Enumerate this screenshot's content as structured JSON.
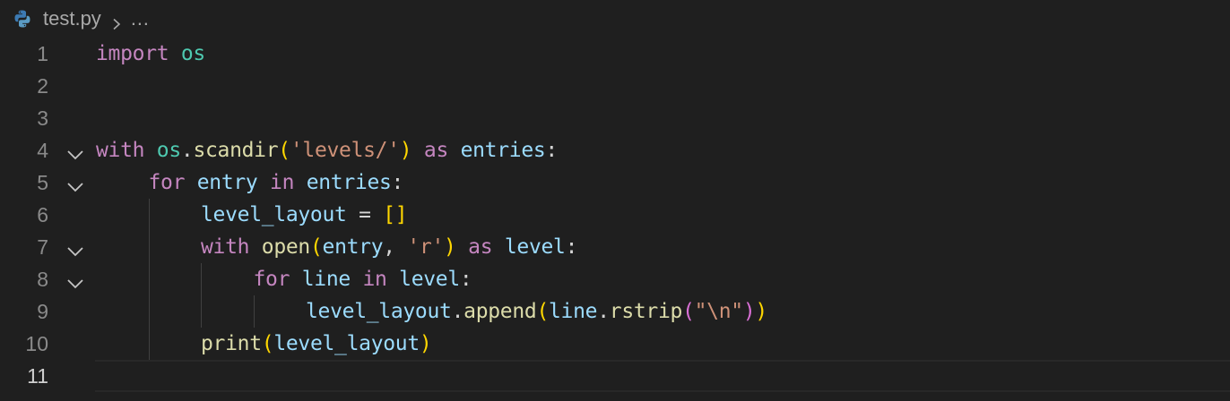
{
  "breadcrumb": {
    "file_icon": "python-file-icon",
    "file_name": "test.py",
    "separator_icon": "chevron-right-icon",
    "more": "…"
  },
  "editor": {
    "current_line": 11,
    "fold_icon": "chevron-down-icon",
    "colors": {
      "background": "#1f1f1f",
      "keyword": "#c586c0",
      "module": "#4ec9b0",
      "variable": "#9cdcfe",
      "function": "#dcdcaa",
      "string": "#ce9178",
      "bracket_level1": "#ffd700",
      "bracket_level2": "#da70d6"
    },
    "lines": [
      {
        "number": "1",
        "foldable": false,
        "indent": 0,
        "tokens": [
          {
            "text": "import",
            "kind": "keyword"
          },
          {
            "text": " ",
            "kind": "punct"
          },
          {
            "text": "os",
            "kind": "module"
          }
        ]
      },
      {
        "number": "2",
        "foldable": false,
        "indent": 0,
        "tokens": []
      },
      {
        "number": "3",
        "foldable": false,
        "indent": 0,
        "tokens": []
      },
      {
        "number": "4",
        "foldable": true,
        "indent": 0,
        "tokens": [
          {
            "text": "with",
            "kind": "keyword"
          },
          {
            "text": " ",
            "kind": "punct"
          },
          {
            "text": "os",
            "kind": "module"
          },
          {
            "text": ".",
            "kind": "punct"
          },
          {
            "text": "scandir",
            "kind": "func"
          },
          {
            "text": "(",
            "kind": "paren1"
          },
          {
            "text": "'levels/'",
            "kind": "string"
          },
          {
            "text": ")",
            "kind": "paren1"
          },
          {
            "text": " ",
            "kind": "punct"
          },
          {
            "text": "as",
            "kind": "keyword"
          },
          {
            "text": " ",
            "kind": "punct"
          },
          {
            "text": "entries",
            "kind": "var"
          },
          {
            "text": ":",
            "kind": "punct"
          }
        ]
      },
      {
        "number": "5",
        "foldable": true,
        "indent": 1,
        "tokens": [
          {
            "text": "for",
            "kind": "keyword"
          },
          {
            "text": " ",
            "kind": "punct"
          },
          {
            "text": "entry",
            "kind": "var"
          },
          {
            "text": " ",
            "kind": "punct"
          },
          {
            "text": "in",
            "kind": "keyword"
          },
          {
            "text": " ",
            "kind": "punct"
          },
          {
            "text": "entries",
            "kind": "var"
          },
          {
            "text": ":",
            "kind": "punct"
          }
        ]
      },
      {
        "number": "6",
        "foldable": false,
        "indent": 2,
        "tokens": [
          {
            "text": "level_layout",
            "kind": "var"
          },
          {
            "text": " = ",
            "kind": "punct"
          },
          {
            "text": "[]",
            "kind": "paren1"
          }
        ]
      },
      {
        "number": "7",
        "foldable": true,
        "indent": 2,
        "tokens": [
          {
            "text": "with",
            "kind": "keyword"
          },
          {
            "text": " ",
            "kind": "punct"
          },
          {
            "text": "open",
            "kind": "func"
          },
          {
            "text": "(",
            "kind": "paren1"
          },
          {
            "text": "entry",
            "kind": "var"
          },
          {
            "text": ", ",
            "kind": "punct"
          },
          {
            "text": "'r'",
            "kind": "string"
          },
          {
            "text": ")",
            "kind": "paren1"
          },
          {
            "text": " ",
            "kind": "punct"
          },
          {
            "text": "as",
            "kind": "keyword"
          },
          {
            "text": " ",
            "kind": "punct"
          },
          {
            "text": "level",
            "kind": "var"
          },
          {
            "text": ":",
            "kind": "punct"
          }
        ]
      },
      {
        "number": "8",
        "foldable": true,
        "indent": 3,
        "tokens": [
          {
            "text": "for",
            "kind": "keyword"
          },
          {
            "text": " ",
            "kind": "punct"
          },
          {
            "text": "line",
            "kind": "var"
          },
          {
            "text": " ",
            "kind": "punct"
          },
          {
            "text": "in",
            "kind": "keyword"
          },
          {
            "text": " ",
            "kind": "punct"
          },
          {
            "text": "level",
            "kind": "var"
          },
          {
            "text": ":",
            "kind": "punct"
          }
        ]
      },
      {
        "number": "9",
        "foldable": false,
        "indent": 4,
        "tokens": [
          {
            "text": "level_layout",
            "kind": "var"
          },
          {
            "text": ".",
            "kind": "punct"
          },
          {
            "text": "append",
            "kind": "func"
          },
          {
            "text": "(",
            "kind": "paren1"
          },
          {
            "text": "line",
            "kind": "var"
          },
          {
            "text": ".",
            "kind": "punct"
          },
          {
            "text": "rstrip",
            "kind": "func"
          },
          {
            "text": "(",
            "kind": "paren2"
          },
          {
            "text": "\"\\n\"",
            "kind": "string"
          },
          {
            "text": ")",
            "kind": "paren2"
          },
          {
            "text": ")",
            "kind": "paren1"
          }
        ]
      },
      {
        "number": "10",
        "foldable": false,
        "indent": 2,
        "tokens": [
          {
            "text": "print",
            "kind": "func"
          },
          {
            "text": "(",
            "kind": "paren1"
          },
          {
            "text": "level_layout",
            "kind": "var"
          },
          {
            "text": ")",
            "kind": "paren1"
          }
        ]
      },
      {
        "number": "11",
        "foldable": false,
        "indent": 0,
        "tokens": []
      }
    ]
  }
}
